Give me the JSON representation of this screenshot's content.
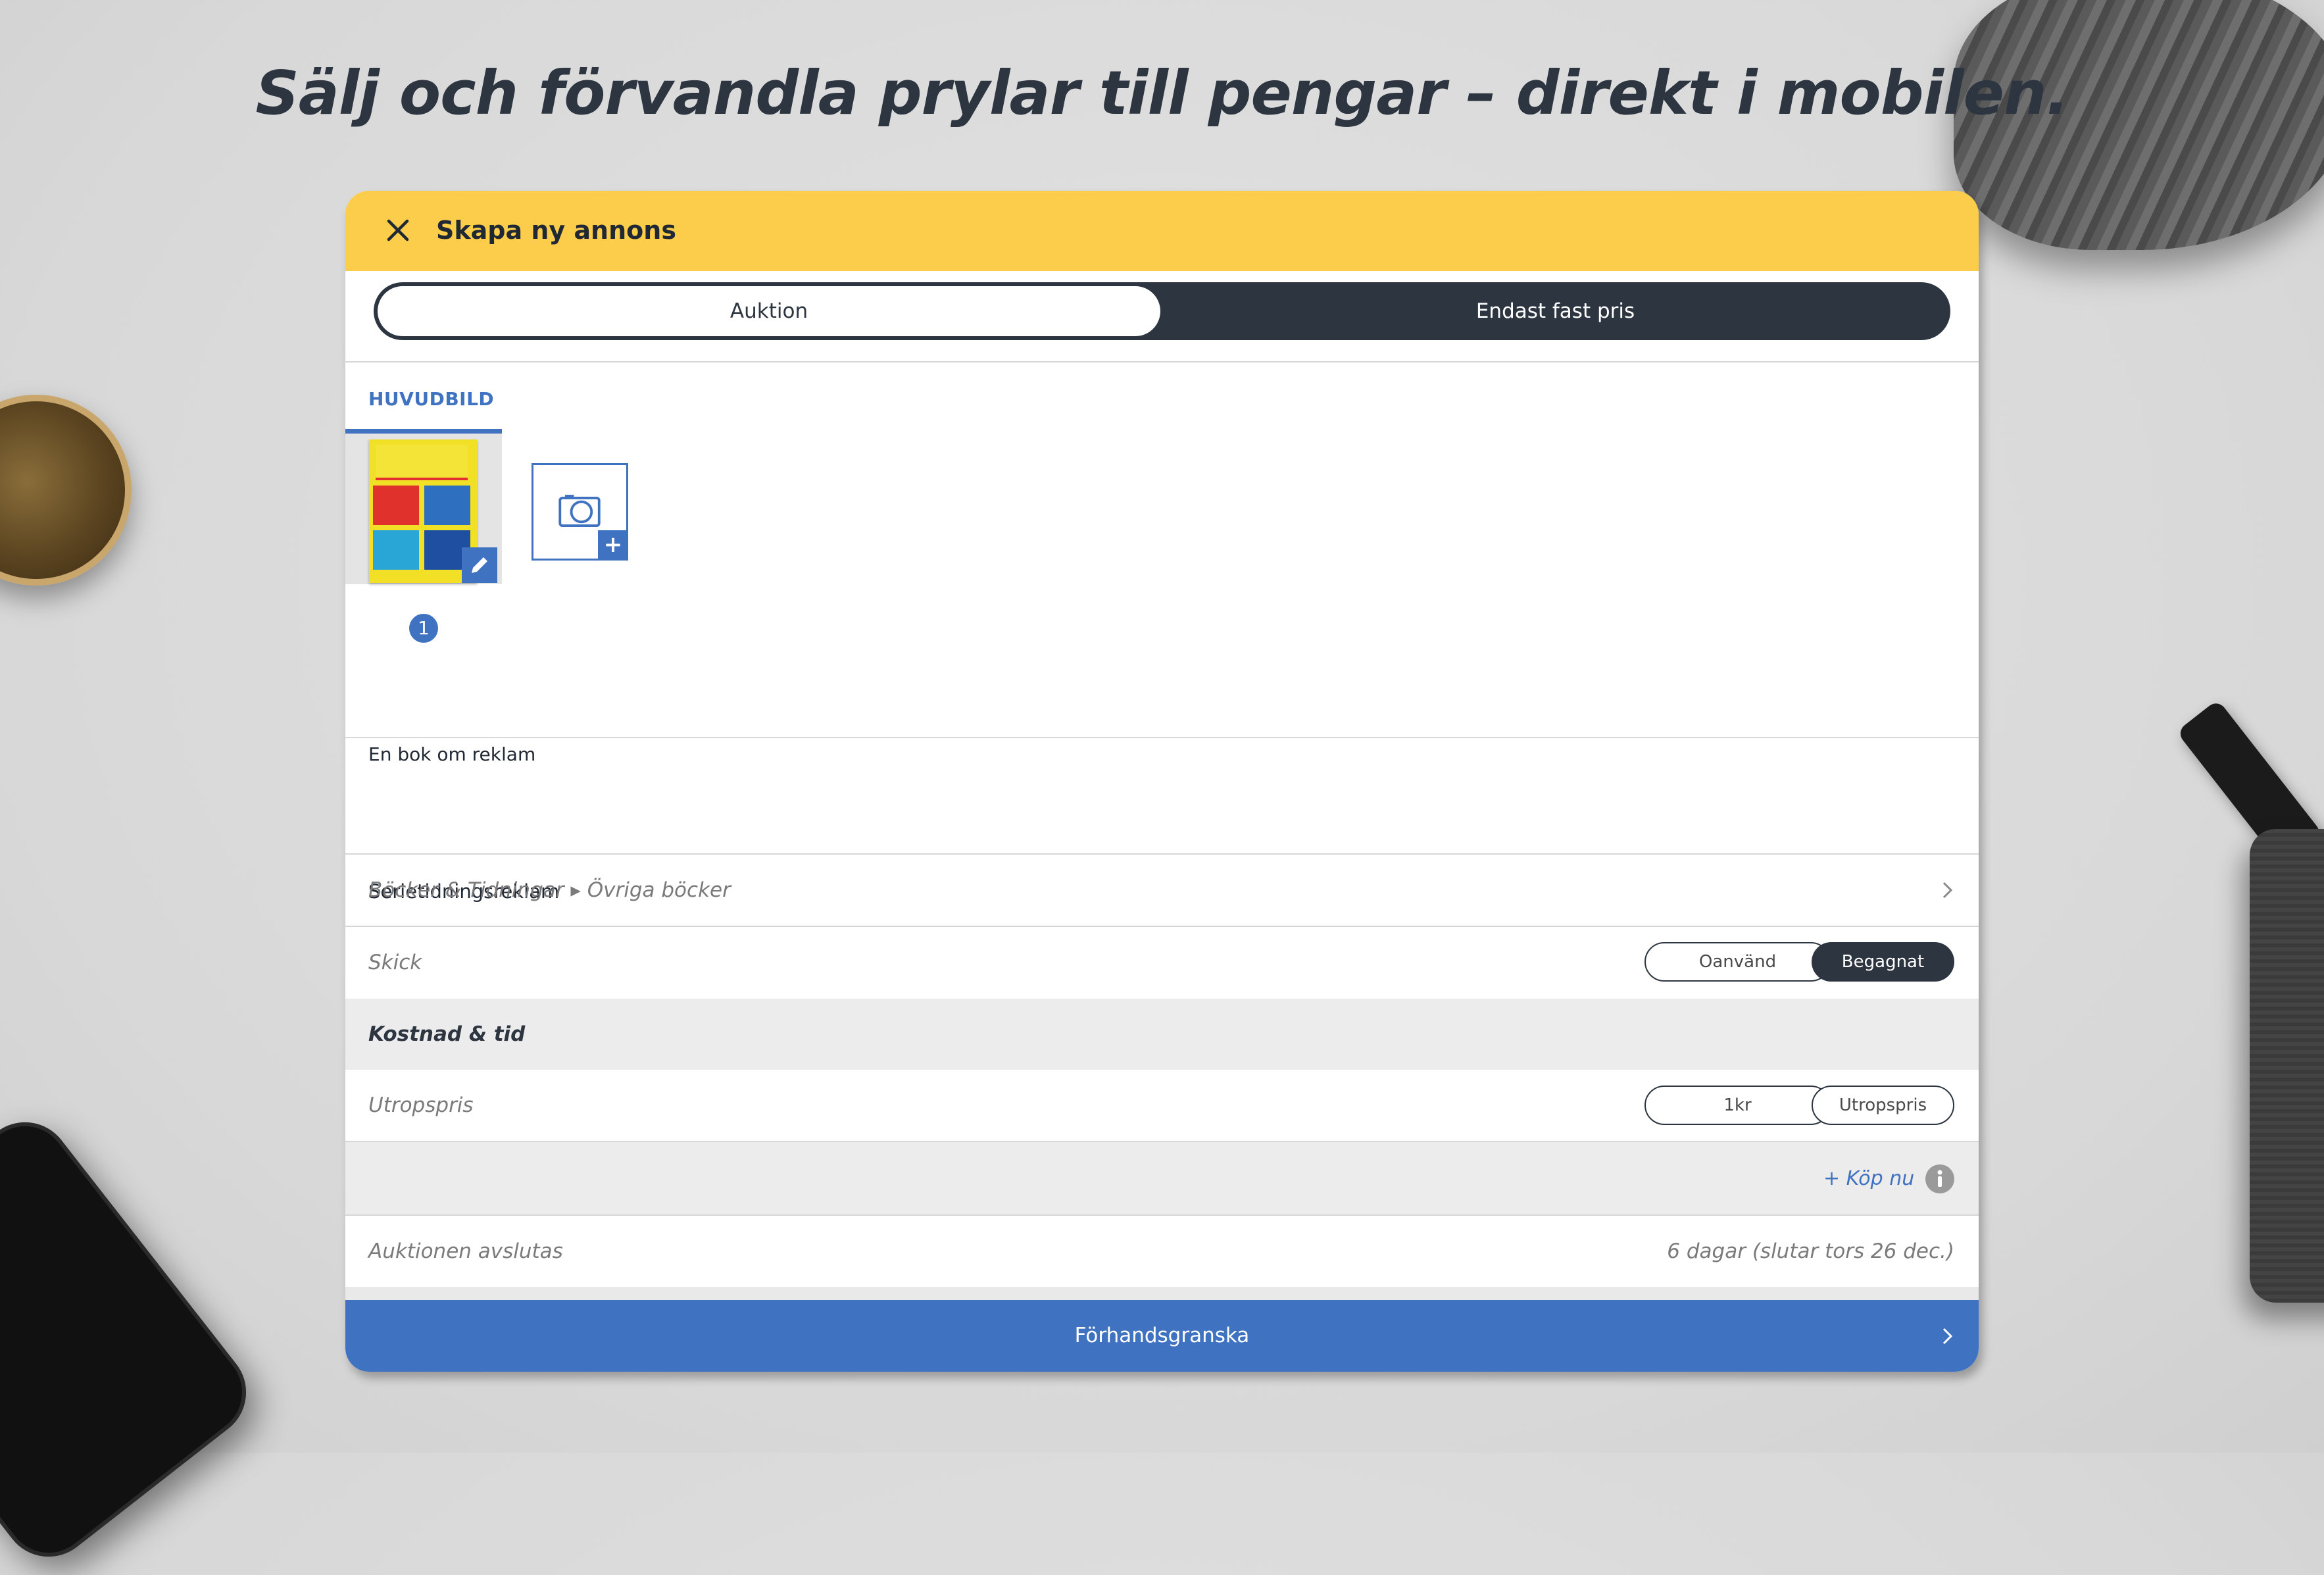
{
  "headline": "Sälj och förvandla prylar till pengar – direkt i mobilen.",
  "header": {
    "title": "Skapa ny annons"
  },
  "listing_type": {
    "options": [
      "Auktion",
      "Endast fast pris"
    ],
    "selected": "Auktion"
  },
  "images": {
    "section_label": "HUVUDBILD",
    "main_index": "1"
  },
  "listing": {
    "title_value": "Serietidningsreklam",
    "description_value": "En bok om reklam",
    "category_path": "Böcker & Tidningar ▸ Övriga böcker"
  },
  "condition": {
    "label": "Skick",
    "options": [
      "Oanvänd",
      "Begagnat"
    ],
    "selected": "Begagnat"
  },
  "cost_section": {
    "label": "Kostnad & tid"
  },
  "starting_price": {
    "label": "Utropspris",
    "options": [
      "1kr",
      "Utropspris"
    ]
  },
  "buy_now": {
    "label": "+ Köp nu"
  },
  "auction_end": {
    "label": "Auktionen avslutas",
    "value": "6 dagar (slutar tors 26 dec.)"
  },
  "footer": {
    "label": "Förhandsgranska"
  },
  "colors": {
    "accent_yellow": "#fbcd4b",
    "primary_blue": "#3f72c0",
    "dark": "#2c3540"
  },
  "icons": [
    "close-icon",
    "edit-icon",
    "camera-icon",
    "chevron-right-icon",
    "info-icon"
  ]
}
